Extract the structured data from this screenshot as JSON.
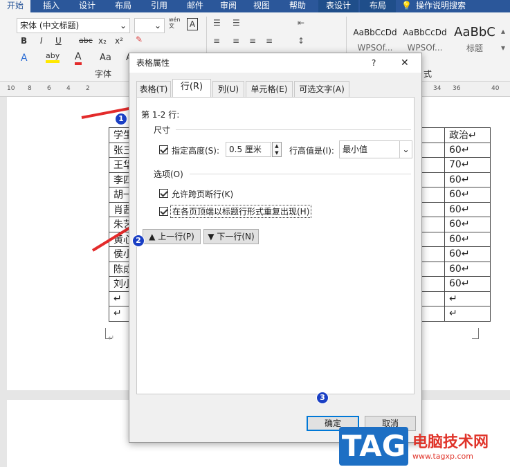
{
  "ribbon": {
    "tabs": [
      "开始",
      "插入",
      "设计",
      "布局",
      "引用",
      "邮件",
      "审阅",
      "视图",
      "帮助",
      "表设计",
      "布局"
    ],
    "tell_me": "操作说明搜索",
    "font_name": "宋体 (中文标题)",
    "font_group_label": "字体",
    "paragraph_group_label": "式",
    "font_buttons": [
      "B",
      "I",
      "U",
      "abc",
      "x₂",
      "x²"
    ],
    "font_buttons_row3": [
      "A",
      "aby",
      "A",
      "Aa",
      "A"
    ],
    "wen_label": "wén\n文",
    "styles": [
      {
        "preview": "AaBbCcDd",
        "name": "WPSOf..."
      },
      {
        "preview": "AaBbCcDd",
        "name": "WPSOf..."
      },
      {
        "preview": "AaBbC",
        "name": "标题"
      }
    ]
  },
  "ruler": {
    "ticks_left": [
      "10",
      "8",
      "6",
      "4",
      "2"
    ],
    "ticks_right": [
      "34",
      "36",
      "40"
    ]
  },
  "document": {
    "col1_rows": [
      "学生姓",
      "张三",
      "王华",
      "李四",
      "胡一",
      "肖茜",
      "朱艺",
      "黄心",
      "侯小",
      "陈成",
      "刘小曾",
      "↵",
      "↵"
    ],
    "col2_rows": [
      "政治↵",
      "60↵",
      "70↵",
      "60↵",
      "60↵",
      "60↵",
      "60↵",
      "60↵",
      "60↵",
      "60↵",
      "60↵",
      "↵",
      "↵"
    ],
    "paragraph_mark": "↵"
  },
  "dialog": {
    "title": "表格属性",
    "help": "?",
    "close": "✕",
    "tabs": [
      "表格(T)",
      "行(R)",
      "列(U)",
      "单元格(E)",
      "可选文字(A)"
    ],
    "active_tab": "行(R)",
    "rows_label": "第 1-2 行:",
    "size_group": "尺寸",
    "specify_height_label": "指定高度(S):",
    "specify_height_checked": true,
    "height_value": "0.5 厘米",
    "height_rule_label": "行高值是(I):",
    "height_rule_value": "最小值",
    "options_group": "选项(O)",
    "allow_break_label": "允许跨页断行(K)",
    "allow_break_checked": true,
    "repeat_header_label": "在各页顶端以标题行形式重复出现(H)",
    "repeat_header_checked": true,
    "prev_row": "上一行(P)",
    "next_row": "下一行(N)",
    "ok": "确定",
    "cancel": "取消"
  },
  "annotations": [
    "1",
    "2",
    "3"
  ],
  "annotation_color": "#e32b2b",
  "watermark": {
    "tag": "TAG",
    "site_name": "电脑技术网",
    "url": "www.tagxp.com"
  }
}
